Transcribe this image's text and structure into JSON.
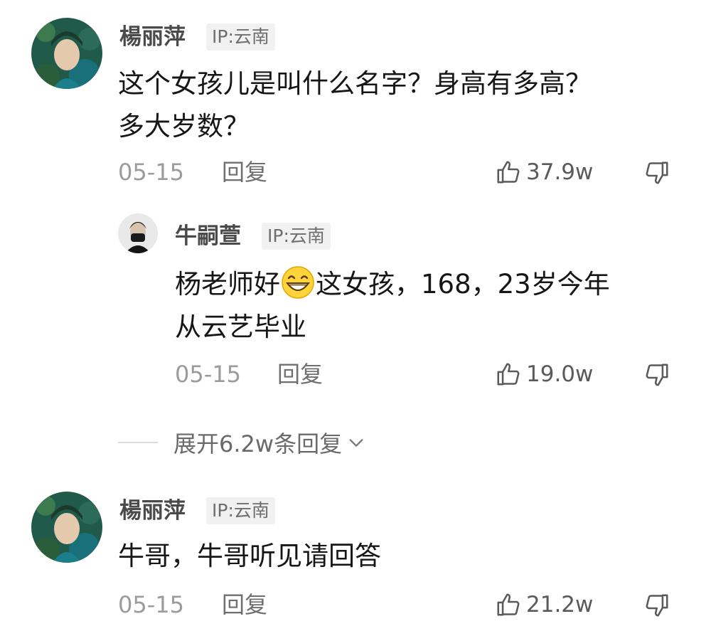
{
  "comments": [
    {
      "user": "楊丽萍",
      "ip": "IP:云南",
      "text_lines": [
        "这个女孩儿是叫什么名字？身高有多高？",
        "多大岁数？"
      ],
      "date": "05-15",
      "reply_label": "回复",
      "likes": "37.9w",
      "reply": {
        "user": "牛嗣萱",
        "ip": "IP:云南",
        "text_line1_before_emoji": "杨老师好",
        "emoji": "grinning-face-emoji",
        "text_line1_after_emoji": "这女孩，168，23岁今年",
        "text_line2": "从云艺毕业",
        "date": "05-15",
        "reply_label": "回复",
        "likes": "19.0w"
      },
      "expand_label": "展开6.2w条回复"
    },
    {
      "user": "楊丽萍",
      "ip": "IP:云南",
      "text_lines": [
        "牛哥，牛哥听见请回答"
      ],
      "date": "05-15",
      "reply_label": "回复",
      "likes": "21.2w"
    }
  ],
  "icons": {
    "like": "thumbs-up-icon",
    "dislike": "thumbs-down-icon",
    "expand": "chevron-down-icon"
  },
  "colors": {
    "username": "#4a4a4a",
    "text": "#161616",
    "meta": "#9b9b9b",
    "badge_bg": "#f1f1f1"
  }
}
